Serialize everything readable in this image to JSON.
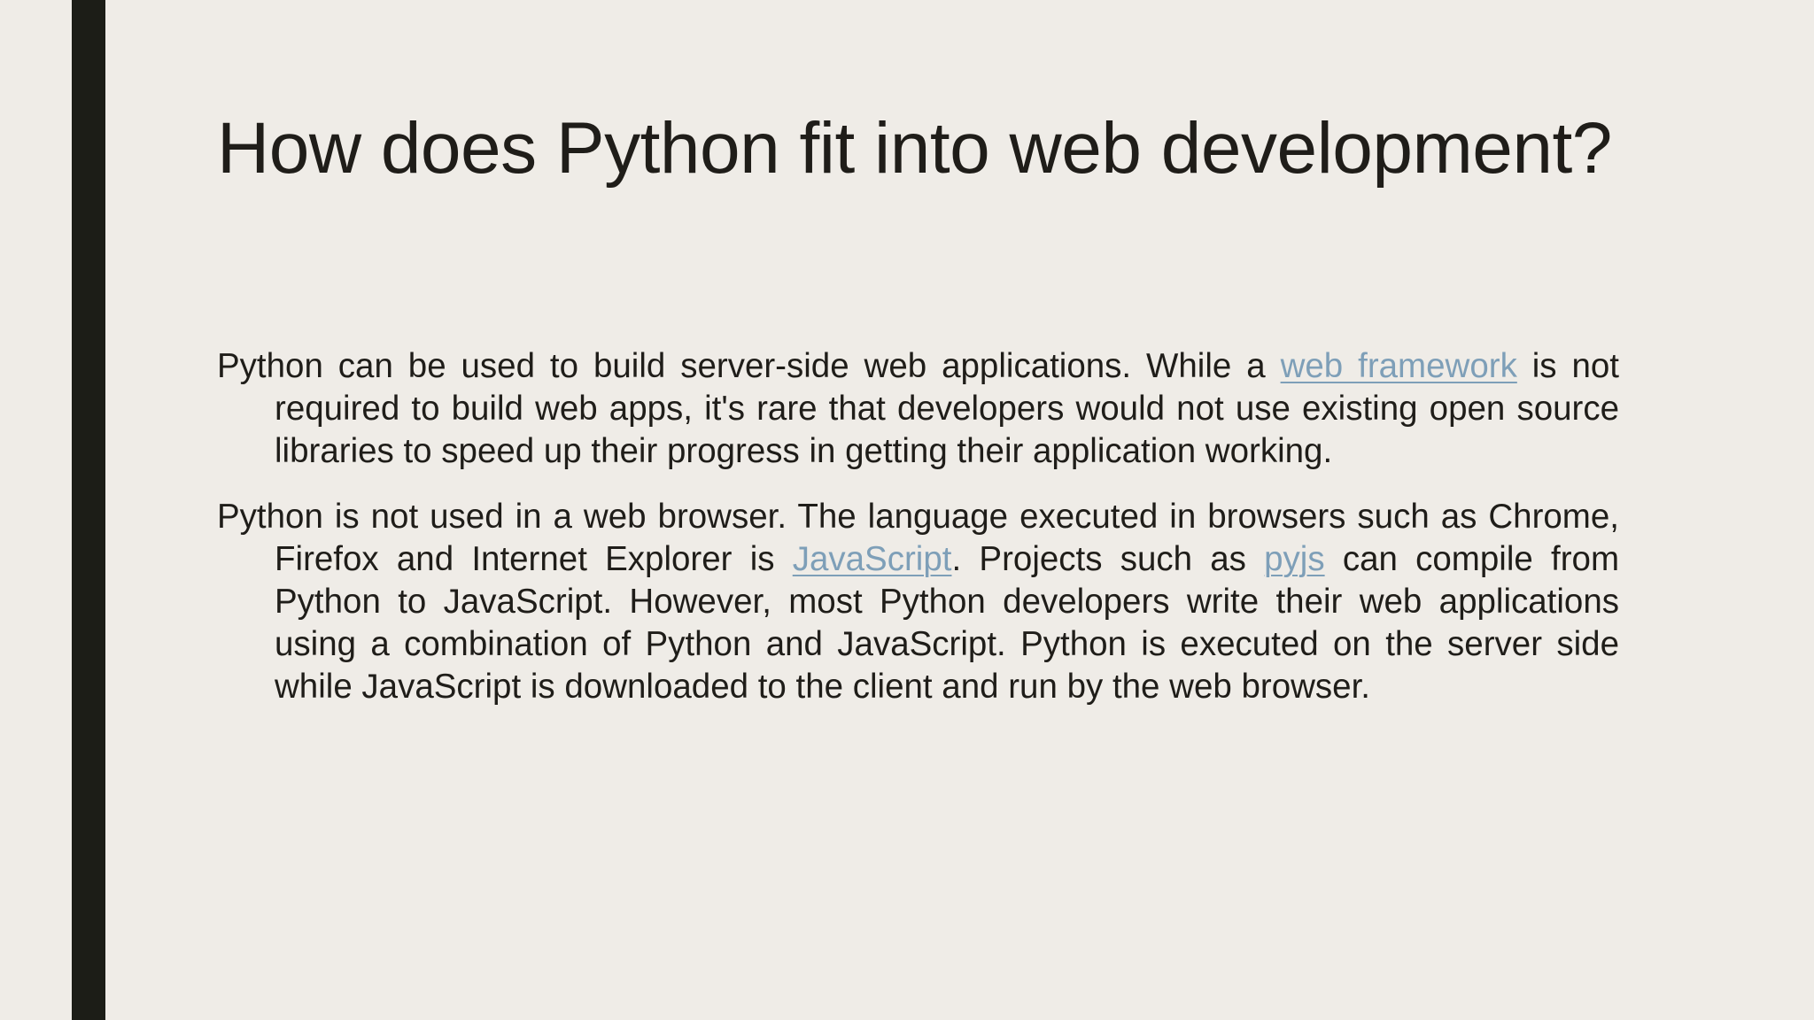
{
  "slide": {
    "title": "How does Python fit into web development?",
    "accent_color": "#1C1D17",
    "background_color": "#EFECE7",
    "link_color": "#7E9FB8",
    "paragraphs": [
      {
        "before_link": "Python can be used to build server-side web applications. While a ",
        "link_text": "web framework",
        "after_link": " is not required to build web apps, it's rare that developers would not use existing open source libraries to speed up their progress in getting their application working."
      },
      {
        "before_link": "Python is not used in a web browser. The language executed in browsers such as Chrome, Firefox and Internet Explorer is ",
        "link1_text": "JavaScript",
        "middle": ". Projects such as ",
        "link2_text": "pyjs",
        "after_link": " can compile from Python to JavaScript. However, most Python developers write their web applications using a combination of Python and JavaScript. Python is executed on the server side while JavaScript is downloaded to the client and run by the web browser."
      }
    ]
  }
}
